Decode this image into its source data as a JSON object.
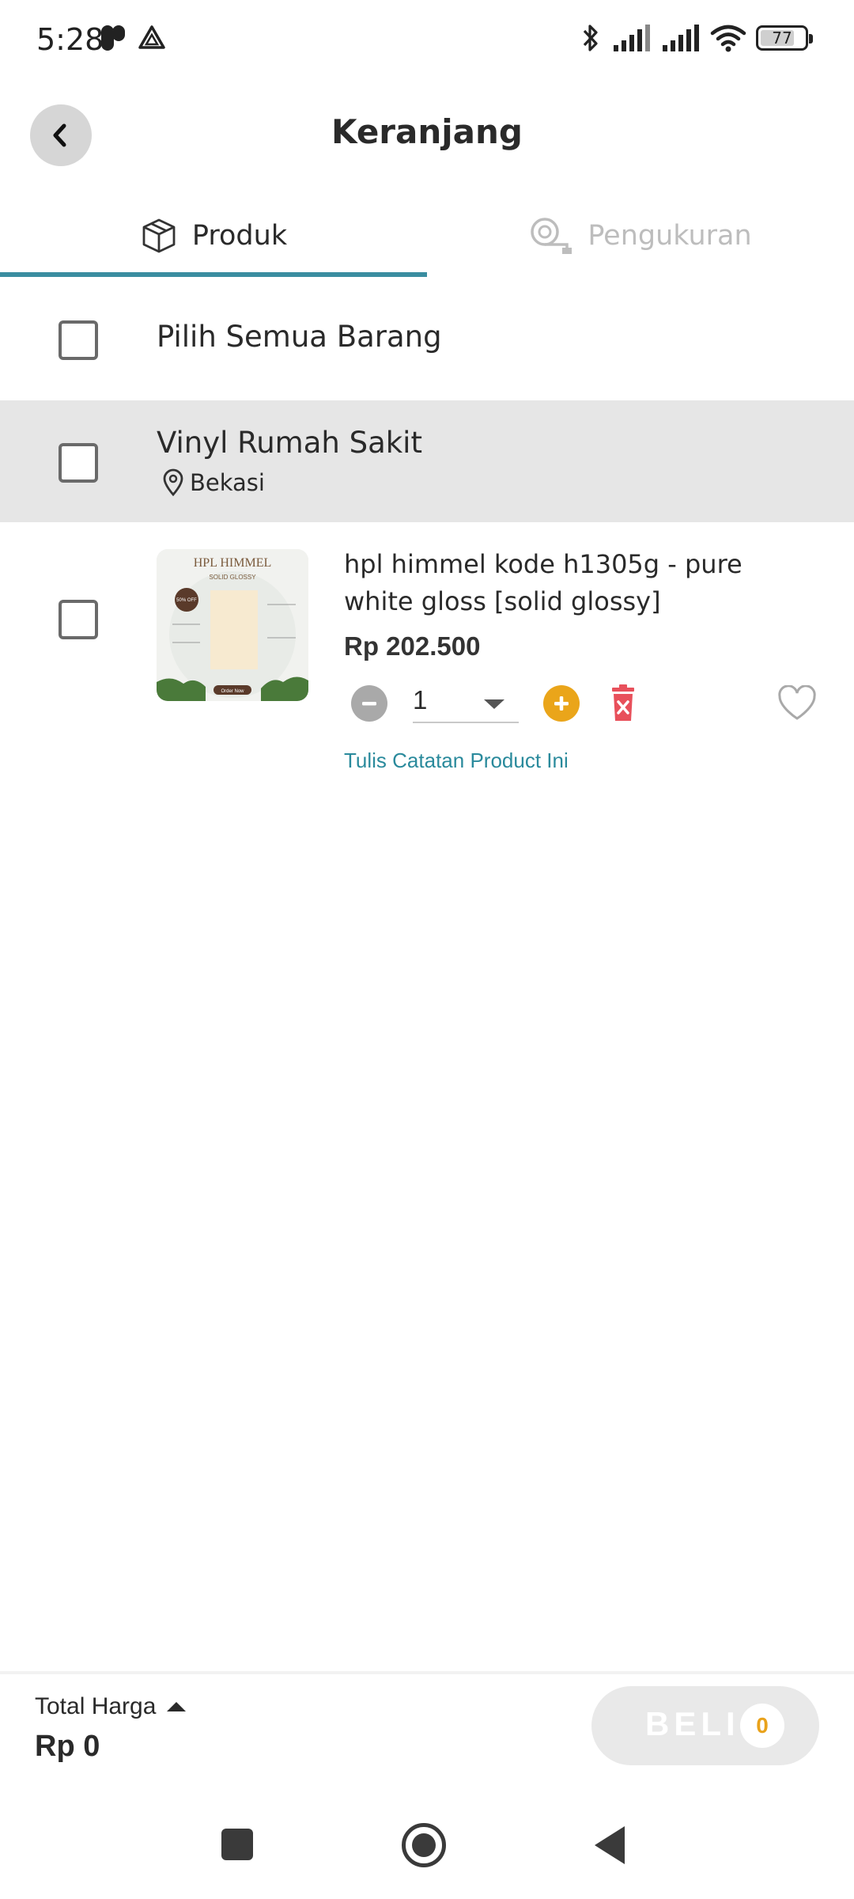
{
  "status_bar": {
    "time": "5:28",
    "battery": "77",
    "battery_level": 0.77
  },
  "header": {
    "title": "Keranjang",
    "back_icon": "chevron-left-icon"
  },
  "tabs": [
    {
      "label": "Produk",
      "icon": "box-icon",
      "active": true
    },
    {
      "label": "Pengukuran",
      "icon": "measuring-tape-icon",
      "active": false
    }
  ],
  "select_all": {
    "label": "Pilih Semua Barang",
    "checked": false
  },
  "store": {
    "name": "Vinyl Rumah Sakit",
    "location": "Bekasi",
    "checked": false
  },
  "product": {
    "name": "hpl himmel kode h1305g - pure white gloss [solid glossy]",
    "price": "Rp 202.500",
    "quantity": "1",
    "note_link": "Tulis Catatan Product Ini",
    "thumbnail": {
      "brand": "HPL HIMMEL",
      "subtitle": "SOLID GLOSSY",
      "badge": "50% OFF",
      "cta": "Order Now"
    }
  },
  "footer": {
    "total_label": "Total Harga",
    "total_value": "Rp 0",
    "buy_label": "BELI",
    "buy_count": "0"
  },
  "colors": {
    "accent": "#3a8da0",
    "link": "#2a8a9c",
    "plus": "#eaa51a",
    "delete": "#e8505b",
    "store_bg": "#e6e6e6"
  }
}
